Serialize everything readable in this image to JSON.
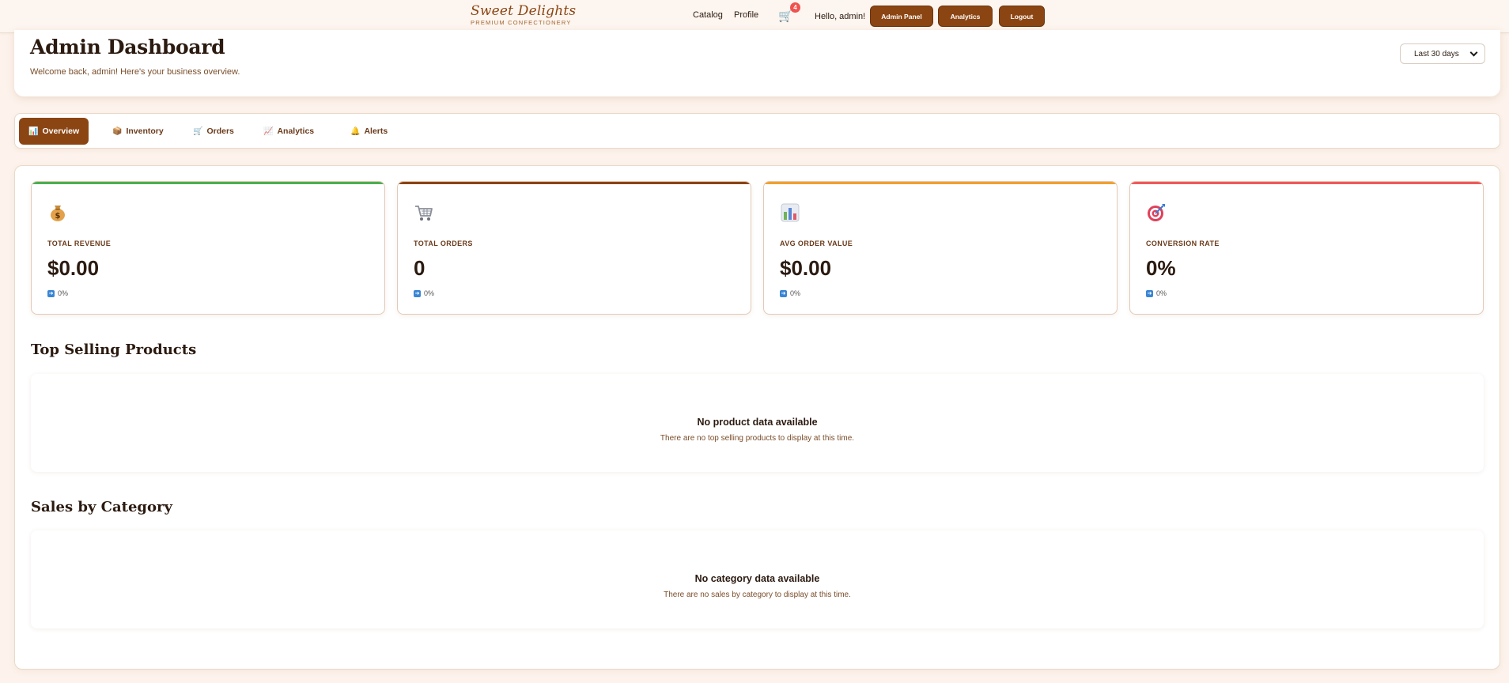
{
  "brand": {
    "name": "Sweet Delights",
    "tagline": "PREMIUM CONFECTIONERY"
  },
  "nav": {
    "links": [
      "Catalog",
      "Profile"
    ],
    "cart_count": "4",
    "greeting": "Hello, admin!",
    "buttons": [
      "Admin Panel",
      "Analytics",
      "Logout"
    ]
  },
  "header": {
    "title": "Admin Dashboard",
    "subtitle": "Welcome back, admin! Here's your business overview.",
    "date_range": "Last 30 days"
  },
  "tabs": [
    {
      "icon": "📊",
      "label": "Overview",
      "active": true
    },
    {
      "icon": "📦",
      "label": "Inventory",
      "active": false
    },
    {
      "icon": "🛒",
      "label": "Orders",
      "active": false
    },
    {
      "icon": "📈",
      "label": "Analytics",
      "active": false
    },
    {
      "icon": "🔔",
      "label": "Alerts",
      "active": false
    }
  ],
  "stats": [
    {
      "icon": "money-bag-icon",
      "label": "TOTAL REVENUE",
      "value": "$0.00",
      "change": "0%",
      "accent": "#4caf50"
    },
    {
      "icon": "cart-icon",
      "label": "TOTAL ORDERS",
      "value": "0",
      "change": "0%",
      "accent": "#8b4513"
    },
    {
      "icon": "bar-chart-icon",
      "label": "AVG ORDER VALUE",
      "value": "$0.00",
      "change": "0%",
      "accent": "#f0a030"
    },
    {
      "icon": "target-icon",
      "label": "CONVERSION RATE",
      "value": "0%",
      "change": "0%",
      "accent": "#ef5a5a"
    }
  ],
  "top_products": {
    "title": "Top Selling Products",
    "empty_title": "No product data available",
    "empty_text": "There are no top selling products to display at this time."
  },
  "category_sales": {
    "title": "Sales by Category",
    "empty_title": "No category data available",
    "empty_text": "There are no sales by category to display at this time."
  }
}
